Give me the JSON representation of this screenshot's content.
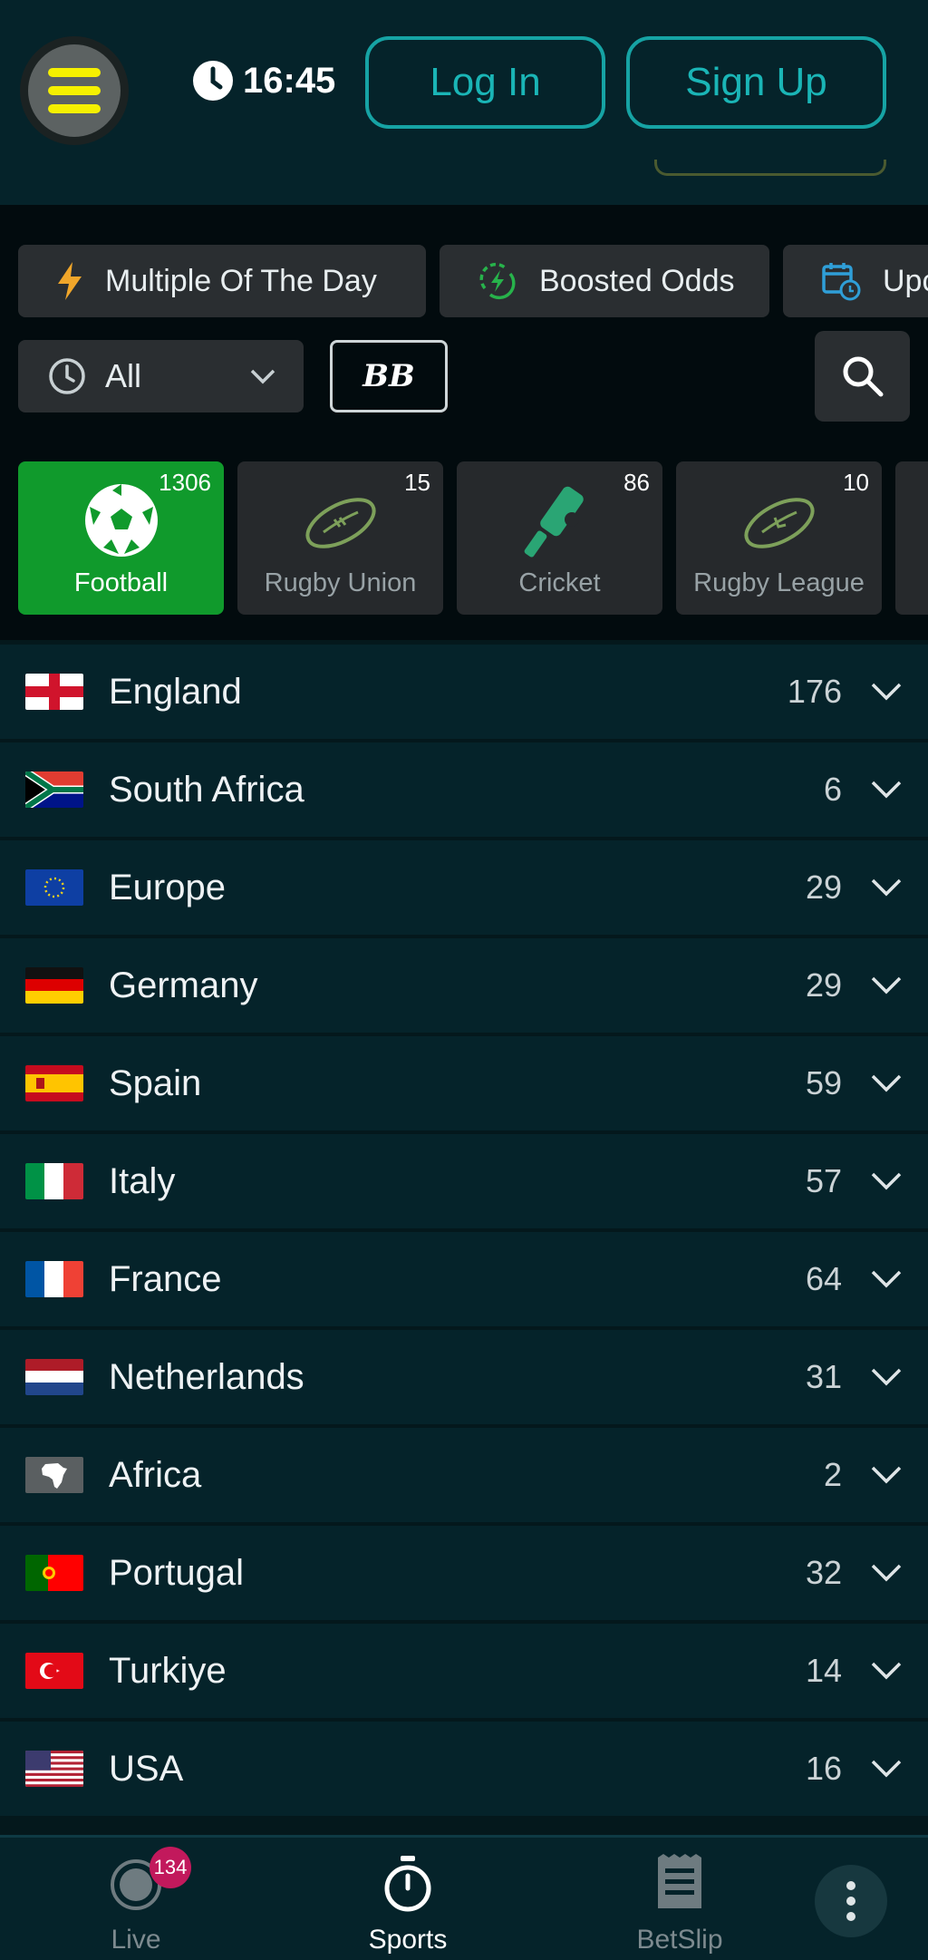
{
  "header": {
    "time": "16:45",
    "login_label": "Log In",
    "signup_label": "Sign Up"
  },
  "quicklinks": [
    {
      "label": "Multiple Of The Day",
      "icon": "lightning-icon"
    },
    {
      "label": "Boosted Odds",
      "icon": "boost-icon"
    },
    {
      "label": "Upc",
      "icon": "calendar-clock-icon"
    }
  ],
  "filter": {
    "selected": "All"
  },
  "bb_label": "BB",
  "sports": [
    {
      "label": "Football",
      "count": "1306",
      "active": true
    },
    {
      "label": "Rugby Union",
      "count": "15"
    },
    {
      "label": "Cricket",
      "count": "86"
    },
    {
      "label": "Rugby League",
      "count": "10"
    }
  ],
  "countries": [
    {
      "name": "England",
      "count": "176"
    },
    {
      "name": "South Africa",
      "count": "6"
    },
    {
      "name": "Europe",
      "count": "29"
    },
    {
      "name": "Germany",
      "count": "29"
    },
    {
      "name": "Spain",
      "count": "59"
    },
    {
      "name": "Italy",
      "count": "57"
    },
    {
      "name": "France",
      "count": "64"
    },
    {
      "name": "Netherlands",
      "count": "31"
    },
    {
      "name": "Africa",
      "count": "2"
    },
    {
      "name": "Portugal",
      "count": "32"
    },
    {
      "name": "Turkiye",
      "count": "14"
    },
    {
      "name": "USA",
      "count": "16"
    }
  ],
  "nav": {
    "live_label": "Live",
    "live_badge": "134",
    "sports_label": "Sports",
    "betslip_label": "BetSlip"
  },
  "colors": {
    "accent_teal": "#16a3a4",
    "active_green": "#109a2c",
    "menu_yellow": "#f5f000",
    "badge_pink": "#c2195c"
  }
}
